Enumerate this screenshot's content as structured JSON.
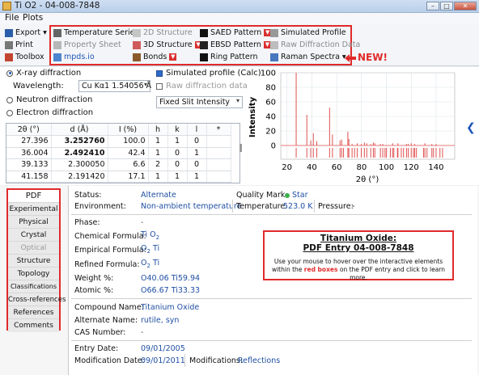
{
  "window": {
    "title": "Ti O2 - 04-008-7848"
  },
  "menu": [
    "File",
    "Plots"
  ],
  "toolbar": {
    "export": "Export",
    "print": "Print",
    "toolbox": "Toolbox",
    "temperature_series": "Temperature Series",
    "property_sheet": "Property Sheet",
    "mpds": "mpds.io",
    "structure_2d": "2D Structure",
    "structure_3d": "3D Structure",
    "bonds": "Bonds",
    "saed": "SAED Pattern",
    "ebsd": "EBSD Pattern",
    "ring": "Ring Pattern",
    "simulated_profile": "Simulated Profile",
    "raw_diffraction": "Raw Diffraction Data",
    "raman": "Raman Spectra",
    "new_label": "NEW!"
  },
  "diffraction": {
    "xray": "X-ray diffraction",
    "neutron": "Neutron diffraction",
    "electron": "Electron diffraction",
    "wavelength_label": "Wavelength:",
    "wavelength_value": "Cu Kα1 1.54056 Å",
    "simulated_profile": "Simulated profile (Calc)",
    "raw_data": "Raw diffraction data",
    "slit_value": "Fixed Slit Intensity"
  },
  "peak_table": {
    "headers": [
      "2θ (°)",
      "d (Å)",
      "I (%)",
      "h",
      "k",
      "l",
      "*"
    ],
    "rows": [
      [
        "27.396",
        "3.252760",
        "100.0",
        "1",
        "1",
        "0",
        ""
      ],
      [
        "36.004",
        "2.492410",
        "42.4",
        "1",
        "0",
        "1",
        ""
      ],
      [
        "39.133",
        "2.300050",
        "6.6",
        "2",
        "0",
        "0",
        ""
      ],
      [
        "41.158",
        "2.191420",
        "17.1",
        "1",
        "1",
        "1",
        ""
      ]
    ]
  },
  "chart_data": {
    "type": "bar",
    "xlabel": "2θ (°)",
    "ylabel": "Intensity",
    "xlim": [
      15,
      155
    ],
    "ylim": [
      0,
      100
    ],
    "xticks": [
      20,
      40,
      60,
      80,
      100,
      120,
      140
    ],
    "yticks": [
      0,
      20,
      40,
      60,
      80,
      100
    ],
    "color": "#e05050",
    "peaks": [
      {
        "x": 27.4,
        "y": 100
      },
      {
        "x": 36.0,
        "y": 42
      },
      {
        "x": 39.1,
        "y": 7
      },
      {
        "x": 41.2,
        "y": 17
      },
      {
        "x": 44.0,
        "y": 6
      },
      {
        "x": 54.3,
        "y": 52
      },
      {
        "x": 56.6,
        "y": 15
      },
      {
        "x": 62.7,
        "y": 7
      },
      {
        "x": 64.0,
        "y": 8
      },
      {
        "x": 69.0,
        "y": 19
      },
      {
        "x": 69.8,
        "y": 9
      },
      {
        "x": 72.4,
        "y": 2
      },
      {
        "x": 76.5,
        "y": 3
      },
      {
        "x": 79.8,
        "y": 2
      },
      {
        "x": 82.3,
        "y": 4
      },
      {
        "x": 84.2,
        "y": 3
      },
      {
        "x": 87.4,
        "y": 2
      },
      {
        "x": 89.5,
        "y": 4
      },
      {
        "x": 90.7,
        "y": 3
      },
      {
        "x": 95.2,
        "y": 2
      },
      {
        "x": 97.1,
        "y": 2
      },
      {
        "x": 105.0,
        "y": 3
      },
      {
        "x": 109.3,
        "y": 3
      },
      {
        "x": 116.2,
        "y": 2
      },
      {
        "x": 117.6,
        "y": 2
      },
      {
        "x": 120.0,
        "y": 3
      },
      {
        "x": 122.8,
        "y": 2
      },
      {
        "x": 131.0,
        "y": 3
      },
      {
        "x": 136.6,
        "y": 2
      },
      {
        "x": 140.0,
        "y": 2
      }
    ],
    "tick_marks": [
      27.4,
      36.0,
      39.1,
      41.2,
      44.0,
      54.3,
      56.6,
      62.7,
      64.0,
      65.5,
      69.0,
      69.8,
      72.4,
      74.4,
      76.5,
      79.8,
      82.3,
      84.2,
      87.4,
      89.5,
      90.7,
      95.2,
      97.1,
      98.9,
      100.1,
      103.2,
      105.0,
      106.0,
      108.9,
      109.3,
      112.0,
      113.8,
      116.2,
      117.6,
      120.0,
      121.8,
      122.8,
      124.2,
      129.9,
      131.0,
      132.7,
      136.6,
      137.9,
      140.0,
      143.1,
      145.2
    ]
  },
  "sidebar": {
    "items": [
      "PDF",
      "Experimental",
      "Physical",
      "Crystal",
      "Optical",
      "Structure",
      "Topology",
      "Classifications",
      "Cross-references",
      "References",
      "Comments"
    ]
  },
  "details": {
    "status_label": "Status:",
    "status_value": "Alternate",
    "quality_label": "Quality Mark:",
    "quality_value": "Star",
    "environment_label": "Environment:",
    "environment_value": "Non-ambient temperature",
    "temperature_label": "Temperature:",
    "temperature_value": "523.0 K",
    "pressure_label": "Pressure:",
    "pressure_value": "-",
    "phase_label": "Phase:",
    "phase_value": "-",
    "chem_formula_label": "Chemical Formula:",
    "chem_formula_value": "Ti O",
    "emp_formula_label": "Empirical Formula:",
    "emp_formula_value": "O",
    "emp_formula_suffix": "Ti",
    "ref_formula_label": "Refined Formula:",
    "ref_formula_value": "O",
    "ref_formula_suffix": "Ti",
    "subscript": "2",
    "weight_label": "Weight %:",
    "weight_value": "O40.06 Ti59.94",
    "atomic_label": "Atomic %:",
    "atomic_value": "O66.67 Ti33.33",
    "compound_label": "Compound Name:",
    "compound_value": "Titanium Oxide",
    "alt_name_label": "Alternate Name:",
    "alt_name_value": "rutile, syn",
    "cas_label": "CAS Number:",
    "cas_value": "-",
    "entry_date_label": "Entry Date:",
    "entry_date_value": "09/01/2005",
    "mod_date_label": "Modification Date:",
    "mod_date_value": "09/01/2011",
    "modifications_label": "Modifications:",
    "modifications_value": "Reflections"
  },
  "infobox": {
    "title": "Titanium Oxide:",
    "subtitle": "PDF Entry 04-008-7848",
    "text_before": "Use your mouse to hover over the interactive elements within the ",
    "text_red": "red boxes",
    "text_after": " on the PDF entry and click to learn more."
  }
}
